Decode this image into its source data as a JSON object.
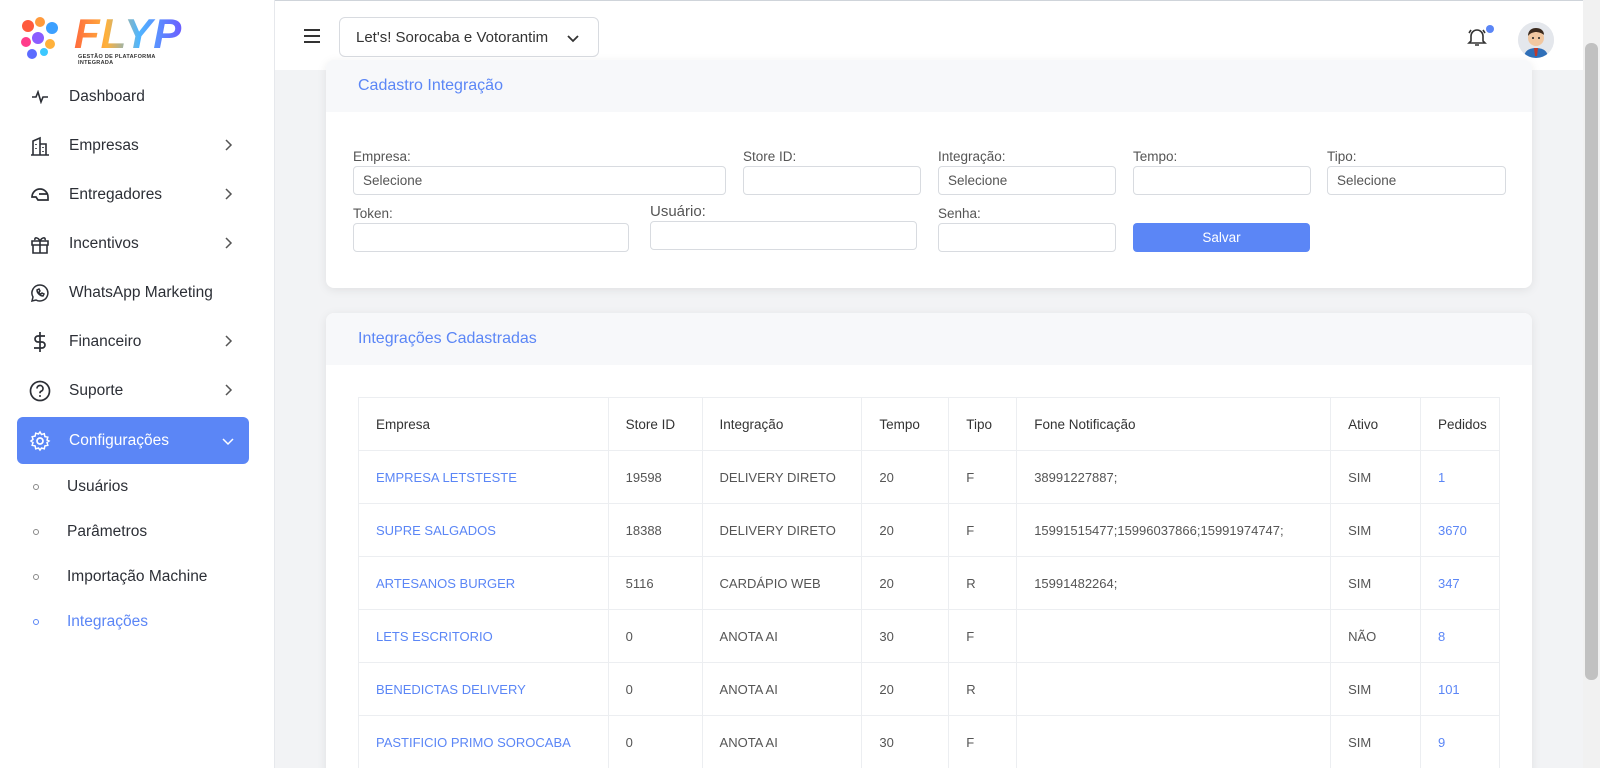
{
  "brand": {
    "name": "FLYP",
    "tagline": "GESTÃO DE PLATAFORMA INTEGRADA"
  },
  "header": {
    "store_select": "Let's! Sorocaba e Votorantim"
  },
  "sidebar": {
    "items": [
      {
        "label": "Dashboard",
        "icon": "activity-icon",
        "has_children": false
      },
      {
        "label": "Empresas",
        "icon": "building-icon",
        "has_children": true
      },
      {
        "label": "Entregadores",
        "icon": "helmet-icon",
        "has_children": true
      },
      {
        "label": "Incentivos",
        "icon": "gift-icon",
        "has_children": true
      },
      {
        "label": "WhatsApp Marketing",
        "icon": "whatsapp-icon",
        "has_children": false
      },
      {
        "label": "Financeiro",
        "icon": "dollar-icon",
        "has_children": true
      },
      {
        "label": "Suporte",
        "icon": "help-circle-icon",
        "has_children": true
      },
      {
        "label": "Configurações",
        "icon": "gear-icon",
        "has_children": true,
        "active": true
      }
    ],
    "sub_items": [
      {
        "label": "Usuários"
      },
      {
        "label": "Parâmetros"
      },
      {
        "label": "Importação Machine"
      },
      {
        "label": "Integrações",
        "current": true
      }
    ]
  },
  "form": {
    "title": "Cadastro Integração",
    "empresa_label": "Empresa:",
    "empresa_value": "Selecione",
    "store_id_label": "Store ID:",
    "integracao_label": "Integração:",
    "integracao_value": "Selecione",
    "tempo_label": "Tempo:",
    "tipo_label": "Tipo:",
    "tipo_value": "Selecione",
    "token_label": "Token:",
    "usuario_label": "Usuário:",
    "senha_label": "Senha:",
    "save_label": "Salvar"
  },
  "table": {
    "title": "Integrações Cadastradas",
    "columns": [
      "Empresa",
      "Store ID",
      "Integração",
      "Tempo",
      "Tipo",
      "Fone Notificação",
      "Ativo",
      "Pedidos"
    ],
    "rows": [
      [
        "EMPRESA LETSTESTE",
        "19598",
        "DELIVERY DIRETO",
        "20",
        "F",
        "38991227887;",
        "SIM",
        "1"
      ],
      [
        "SUPRE SALGADOS",
        "18388",
        "DELIVERY DIRETO",
        "20",
        "F",
        "15991515477;15996037866;15991974747;",
        "SIM",
        "3670"
      ],
      [
        "ARTESANOS BURGER",
        "5116",
        "CARDÁPIO WEB",
        "20",
        "R",
        "15991482264;",
        "SIM",
        "347"
      ],
      [
        "LETS ESCRITORIO",
        "0",
        "ANOTA AI",
        "30",
        "F",
        "",
        "NÃO",
        "8"
      ],
      [
        "BENEDICTAS DELIVERY",
        "0",
        "ANOTA AI",
        "20",
        "R",
        "",
        "SIM",
        "101"
      ],
      [
        "PASTIFICIO PRIMO SOROCABA",
        "0",
        "ANOTA AI",
        "30",
        "F",
        "",
        "SIM",
        "9"
      ]
    ]
  },
  "colors": {
    "accent": "#5b86f6",
    "notification_dot": "#5b86f6"
  }
}
